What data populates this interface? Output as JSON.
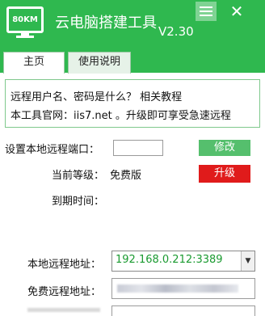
{
  "app": {
    "logo_text": "80KM",
    "title": "云电脑搭建工具",
    "version": "V2.30",
    "menu_icon": "hamburger-icon",
    "close_icon": "close-icon"
  },
  "tabs": [
    {
      "label": "主页"
    },
    {
      "label": "使用说明"
    }
  ],
  "notice": {
    "line1": "远程用户名、密码是什么？ 相关教程",
    "line2": "本工具官网：iis7.net 。升级即可享受急速远程"
  },
  "settings": {
    "port_label": "设置本地远程端口：",
    "port_value": "",
    "modify_label": "修改",
    "level_label": "当前等级：",
    "level_value": "免费版",
    "upgrade_label": "升级",
    "expire_label": "到期时间：",
    "local_addr_label": "本地远程地址：",
    "local_addr_value": "192.168.0.212:3389",
    "free_addr_label": "免费远程地址："
  },
  "colors": {
    "brand_green": "#2fb84f",
    "upgrade_red": "#e01b1b",
    "address_green": "#1a9a30"
  }
}
